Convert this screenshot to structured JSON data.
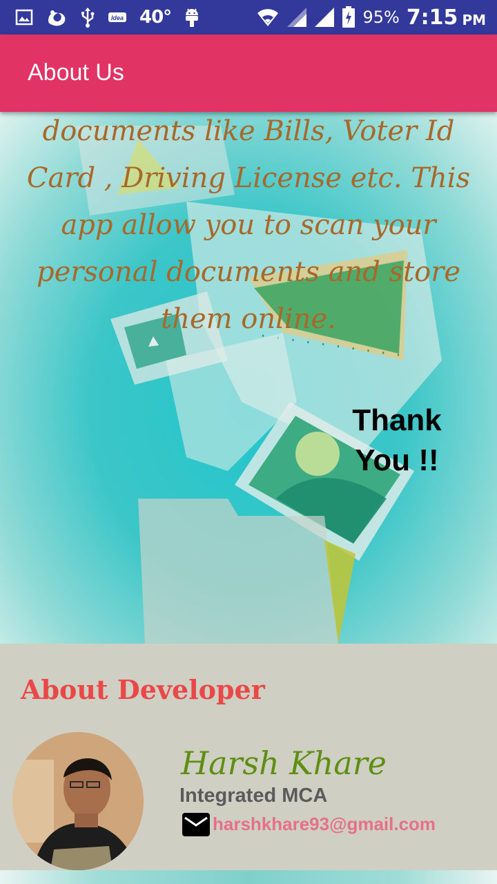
{
  "status_bar": {
    "temperature": "40°",
    "battery_percent": "95%",
    "time": "7:15",
    "ampm": "PM",
    "icons": [
      "gallery-icon",
      "uc-browser-icon",
      "usb-icon",
      "idea-sim-icon",
      "temperature-icon",
      "android-icon",
      "wifi-icon",
      "signal-icon",
      "signal-icon",
      "battery-charging-icon"
    ]
  },
  "app_bar": {
    "title": "About Us"
  },
  "hero": {
    "description": "documents like Bills, Voter Id Card , Driving License etc. This app allow you to scan your personal documents and store them online.",
    "thank_you": "Thank You !!"
  },
  "developer": {
    "heading": "About Developer",
    "name": "Harsh Khare",
    "degree": "Integrated MCA",
    "email": "harshkhare93@gmail.com"
  },
  "colors": {
    "status_bar": "#33399a",
    "app_bar": "#e23464",
    "heading": "#ea4848",
    "name": "#5f8f12",
    "email": "#e6708a",
    "panel": "#cfcfc3"
  }
}
